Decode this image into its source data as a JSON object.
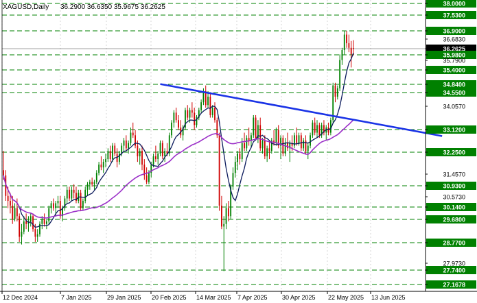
{
  "header": {
    "symbol": "XAGUSD,Daily",
    "ohlc": "36.2900 36.6350 35.9675 36.2625"
  },
  "colors": {
    "background": "#ffffff",
    "grid": "#b9b9b9",
    "level_line": "#008000",
    "level_label_bg": "#008000",
    "level_label_text": "#ffffff",
    "price_label_bg": "#000000",
    "price_label_text": "#ffffff",
    "bull_candle": "#008000",
    "bear_candle": "#d00000",
    "ma_fast": "#0b1a5c",
    "ma_slow": "#9b30c8",
    "trendline": "#1a33e6",
    "axis_text": "#000000"
  },
  "chart_data": {
    "type": "candlestick",
    "symbol": "XAGUSD",
    "timeframe": "Daily",
    "grid": true,
    "ylim": [
      27.0,
      38.1
    ],
    "x_tick_labels": [
      "12 Dec 2024",
      "7 Jan 2025",
      "29 Jan 2025",
      "20 Feb 2025",
      "14 Mar 2025",
      "7 Apr 2025",
      "30 Apr 2025",
      "22 May 2025",
      "13 Jun 2025"
    ],
    "y_axis_labels": [
      {
        "value": 38.0,
        "label": "38.0000",
        "style": "level"
      },
      {
        "value": 37.53,
        "label": "37.5300",
        "style": "level"
      },
      {
        "value": 36.9,
        "label": "36.9000",
        "style": "level"
      },
      {
        "value": 36.683,
        "label": "36.6830",
        "style": "plain"
      },
      {
        "value": 36.2625,
        "label": "36.2625",
        "style": "price"
      },
      {
        "value": 35.98,
        "label": "35.9800",
        "style": "level"
      },
      {
        "value": 35.79,
        "label": "35.7900",
        "style": "plain"
      },
      {
        "value": 35.4,
        "label": "35.4000",
        "style": "level"
      },
      {
        "value": 34.84,
        "label": "34.8400",
        "style": "level"
      },
      {
        "value": 34.55,
        "label": "34.5500",
        "style": "level"
      },
      {
        "value": 34.057,
        "label": "34.0570",
        "style": "plain"
      },
      {
        "value": 33.12,
        "label": "33.1200",
        "style": "level"
      },
      {
        "value": 32.25,
        "label": "32.2500",
        "style": "level"
      },
      {
        "value": 31.457,
        "label": "31.4570",
        "style": "plain"
      },
      {
        "value": 30.93,
        "label": "30.9300",
        "style": "level"
      },
      {
        "value": 30.573,
        "label": "30.5730",
        "style": "plain"
      },
      {
        "value": 30.14,
        "label": "30.1400",
        "style": "level"
      },
      {
        "value": 29.68,
        "label": "29.6800",
        "style": "level"
      },
      {
        "value": 28.77,
        "label": "28.7700",
        "style": "level"
      },
      {
        "value": 27.973,
        "label": "27.9730",
        "style": "plain"
      },
      {
        "value": 27.74,
        "label": "27.7400",
        "style": "level"
      },
      {
        "value": 27.1678,
        "label": "27.1678",
        "style": "level"
      }
    ],
    "horizontal_levels": [
      38.0,
      37.53,
      36.9,
      35.98,
      35.4,
      34.84,
      34.55,
      33.12,
      32.25,
      30.93,
      30.14,
      29.68,
      28.77,
      27.74,
      27.1678
    ],
    "current_price": 36.2625,
    "trendline": {
      "from": {
        "bar": 69,
        "value": 34.85
      },
      "to": {
        "bar": 193,
        "value": 32.87
      }
    },
    "candles": [
      {
        "o": 31.6,
        "h": 32.3,
        "l": 31.2,
        "c": 31.4
      },
      {
        "o": 31.4,
        "h": 31.6,
        "l": 30.4,
        "c": 30.6
      },
      {
        "o": 30.6,
        "h": 30.9,
        "l": 30.1,
        "c": 30.4
      },
      {
        "o": 30.4,
        "h": 30.7,
        "l": 29.9,
        "c": 30.2
      },
      {
        "o": 30.2,
        "h": 30.6,
        "l": 29.5,
        "c": 29.7
      },
      {
        "o": 29.7,
        "h": 30.3,
        "l": 29.6,
        "c": 30.1
      },
      {
        "o": 30.1,
        "h": 30.5,
        "l": 29.6,
        "c": 29.8
      },
      {
        "o": 29.8,
        "h": 29.9,
        "l": 28.8,
        "c": 29.0
      },
      {
        "o": 29.0,
        "h": 29.5,
        "l": 28.7,
        "c": 29.2
      },
      {
        "o": 29.2,
        "h": 29.8,
        "l": 29.1,
        "c": 29.6
      },
      {
        "o": 29.6,
        "h": 29.9,
        "l": 29.3,
        "c": 29.5
      },
      {
        "o": 29.5,
        "h": 29.8,
        "l": 29.2,
        "c": 29.6
      },
      {
        "o": 29.6,
        "h": 29.9,
        "l": 29.4,
        "c": 29.8
      },
      {
        "o": 29.8,
        "h": 29.9,
        "l": 29.2,
        "c": 29.3
      },
      {
        "o": 29.3,
        "h": 29.5,
        "l": 28.8,
        "c": 29.0
      },
      {
        "o": 29.0,
        "h": 29.3,
        "l": 28.8,
        "c": 29.1
      },
      {
        "o": 29.1,
        "h": 29.6,
        "l": 29.0,
        "c": 29.5
      },
      {
        "o": 29.5,
        "h": 29.8,
        "l": 29.3,
        "c": 29.7
      },
      {
        "o": 29.7,
        "h": 29.9,
        "l": 29.4,
        "c": 29.5
      },
      {
        "o": 29.5,
        "h": 29.7,
        "l": 29.3,
        "c": 29.6
      },
      {
        "o": 29.6,
        "h": 30.2,
        "l": 29.5,
        "c": 30.1
      },
      {
        "o": 30.1,
        "h": 30.4,
        "l": 29.9,
        "c": 30.3
      },
      {
        "o": 30.3,
        "h": 30.5,
        "l": 30.0,
        "c": 30.1
      },
      {
        "o": 30.1,
        "h": 30.4,
        "l": 29.8,
        "c": 30.3
      },
      {
        "o": 30.3,
        "h": 30.6,
        "l": 30.1,
        "c": 30.4
      },
      {
        "o": 30.4,
        "h": 30.6,
        "l": 29.7,
        "c": 29.8
      },
      {
        "o": 29.8,
        "h": 30.2,
        "l": 29.6,
        "c": 30.1
      },
      {
        "o": 30.1,
        "h": 30.6,
        "l": 30.0,
        "c": 30.5
      },
      {
        "o": 30.5,
        "h": 30.9,
        "l": 30.3,
        "c": 30.8
      },
      {
        "o": 30.8,
        "h": 30.9,
        "l": 30.4,
        "c": 30.5
      },
      {
        "o": 30.5,
        "h": 30.9,
        "l": 30.4,
        "c": 30.8
      },
      {
        "o": 30.8,
        "h": 31.0,
        "l": 30.5,
        "c": 30.7
      },
      {
        "o": 30.7,
        "h": 30.9,
        "l": 30.3,
        "c": 30.4
      },
      {
        "o": 30.4,
        "h": 30.8,
        "l": 30.3,
        "c": 30.7
      },
      {
        "o": 30.7,
        "h": 30.8,
        "l": 30.0,
        "c": 30.1
      },
      {
        "o": 30.1,
        "h": 30.5,
        "l": 30.0,
        "c": 30.4
      },
      {
        "o": 30.4,
        "h": 30.9,
        "l": 30.3,
        "c": 30.8
      },
      {
        "o": 30.8,
        "h": 31.1,
        "l": 30.6,
        "c": 31.0
      },
      {
        "o": 31.0,
        "h": 31.2,
        "l": 30.8,
        "c": 31.1
      },
      {
        "o": 31.1,
        "h": 31.3,
        "l": 30.9,
        "c": 31.0
      },
      {
        "o": 31.0,
        "h": 31.2,
        "l": 30.8,
        "c": 31.1
      },
      {
        "o": 31.1,
        "h": 31.6,
        "l": 31.0,
        "c": 31.5
      },
      {
        "o": 31.5,
        "h": 31.9,
        "l": 31.4,
        "c": 31.8
      },
      {
        "o": 31.8,
        "h": 32.1,
        "l": 31.6,
        "c": 31.7
      },
      {
        "o": 31.7,
        "h": 32.0,
        "l": 31.5,
        "c": 31.9
      },
      {
        "o": 31.9,
        "h": 32.2,
        "l": 31.7,
        "c": 32.0
      },
      {
        "o": 32.0,
        "h": 32.4,
        "l": 31.9,
        "c": 32.3
      },
      {
        "o": 32.3,
        "h": 32.5,
        "l": 31.9,
        "c": 32.0
      },
      {
        "o": 32.0,
        "h": 32.6,
        "l": 31.9,
        "c": 32.5
      },
      {
        "o": 32.5,
        "h": 32.6,
        "l": 32.1,
        "c": 32.2
      },
      {
        "o": 32.2,
        "h": 32.4,
        "l": 31.7,
        "c": 31.9
      },
      {
        "o": 31.9,
        "h": 32.3,
        "l": 31.8,
        "c": 32.2
      },
      {
        "o": 32.2,
        "h": 32.6,
        "l": 32.1,
        "c": 32.5
      },
      {
        "o": 32.5,
        "h": 32.8,
        "l": 32.3,
        "c": 32.7
      },
      {
        "o": 32.7,
        "h": 32.9,
        "l": 32.3,
        "c": 32.4
      },
      {
        "o": 32.4,
        "h": 32.7,
        "l": 32.2,
        "c": 32.6
      },
      {
        "o": 32.6,
        "h": 33.2,
        "l": 32.5,
        "c": 33.0
      },
      {
        "o": 33.0,
        "h": 33.4,
        "l": 32.8,
        "c": 32.9
      },
      {
        "o": 32.9,
        "h": 33.1,
        "l": 32.4,
        "c": 32.5
      },
      {
        "o": 32.5,
        "h": 32.7,
        "l": 31.9,
        "c": 32.1
      },
      {
        "o": 32.1,
        "h": 32.4,
        "l": 31.8,
        "c": 32.3
      },
      {
        "o": 32.3,
        "h": 32.5,
        "l": 31.6,
        "c": 31.8
      },
      {
        "o": 31.8,
        "h": 32.0,
        "l": 31.2,
        "c": 31.4
      },
      {
        "o": 31.4,
        "h": 31.7,
        "l": 31.0,
        "c": 31.1
      },
      {
        "o": 31.1,
        "h": 31.6,
        "l": 31.0,
        "c": 31.5
      },
      {
        "o": 31.5,
        "h": 31.9,
        "l": 31.3,
        "c": 31.8
      },
      {
        "o": 31.8,
        "h": 32.2,
        "l": 31.7,
        "c": 32.1
      },
      {
        "o": 32.1,
        "h": 32.5,
        "l": 31.9,
        "c": 32.0
      },
      {
        "o": 32.0,
        "h": 32.3,
        "l": 31.8,
        "c": 32.2
      },
      {
        "o": 32.2,
        "h": 32.7,
        "l": 32.1,
        "c": 32.6
      },
      {
        "o": 32.6,
        "h": 32.7,
        "l": 32.0,
        "c": 32.1
      },
      {
        "o": 32.1,
        "h": 32.4,
        "l": 31.9,
        "c": 32.3
      },
      {
        "o": 32.3,
        "h": 32.6,
        "l": 32.1,
        "c": 32.2
      },
      {
        "o": 32.2,
        "h": 33.0,
        "l": 32.1,
        "c": 32.9
      },
      {
        "o": 32.9,
        "h": 33.5,
        "l": 32.8,
        "c": 33.4
      },
      {
        "o": 33.4,
        "h": 33.9,
        "l": 33.2,
        "c": 33.8
      },
      {
        "o": 33.8,
        "h": 34.0,
        "l": 33.4,
        "c": 33.5
      },
      {
        "o": 33.5,
        "h": 33.7,
        "l": 33.1,
        "c": 33.2
      },
      {
        "o": 33.2,
        "h": 33.5,
        "l": 32.8,
        "c": 32.9
      },
      {
        "o": 32.9,
        "h": 33.3,
        "l": 32.7,
        "c": 33.2
      },
      {
        "o": 33.2,
        "h": 34.0,
        "l": 33.1,
        "c": 33.9
      },
      {
        "o": 33.9,
        "h": 34.1,
        "l": 33.5,
        "c": 33.6
      },
      {
        "o": 33.6,
        "h": 34.0,
        "l": 33.4,
        "c": 33.9
      },
      {
        "o": 33.9,
        "h": 34.2,
        "l": 33.6,
        "c": 33.8
      },
      {
        "o": 33.8,
        "h": 34.0,
        "l": 33.1,
        "c": 33.3
      },
      {
        "o": 33.3,
        "h": 33.7,
        "l": 33.2,
        "c": 33.6
      },
      {
        "o": 33.6,
        "h": 34.0,
        "l": 33.5,
        "c": 33.9
      },
      {
        "o": 33.9,
        "h": 34.3,
        "l": 33.8,
        "c": 34.2
      },
      {
        "o": 34.2,
        "h": 34.7,
        "l": 34.1,
        "c": 34.6
      },
      {
        "o": 34.6,
        "h": 34.8,
        "l": 34.0,
        "c": 34.1
      },
      {
        "o": 34.1,
        "h": 34.6,
        "l": 34.0,
        "c": 34.4
      },
      {
        "o": 34.4,
        "h": 34.5,
        "l": 33.6,
        "c": 33.7
      },
      {
        "o": 33.7,
        "h": 34.1,
        "l": 33.6,
        "c": 34.0
      },
      {
        "o": 34.0,
        "h": 34.2,
        "l": 33.4,
        "c": 33.5
      },
      {
        "o": 33.5,
        "h": 33.6,
        "l": 32.8,
        "c": 32.9
      },
      {
        "o": 32.9,
        "h": 33.0,
        "l": 30.0,
        "c": 30.2
      },
      {
        "o": 30.2,
        "h": 30.6,
        "l": 29.3,
        "c": 29.4
      },
      {
        "o": 29.4,
        "h": 29.8,
        "l": 27.7,
        "c": 29.5
      },
      {
        "o": 29.5,
        "h": 30.3,
        "l": 29.3,
        "c": 30.1
      },
      {
        "o": 30.1,
        "h": 30.4,
        "l": 29.6,
        "c": 29.8
      },
      {
        "o": 29.8,
        "h": 31.0,
        "l": 29.7,
        "c": 30.9
      },
      {
        "o": 30.9,
        "h": 31.7,
        "l": 30.8,
        "c": 31.5
      },
      {
        "o": 31.5,
        "h": 32.1,
        "l": 31.3,
        "c": 31.9
      },
      {
        "o": 31.9,
        "h": 32.3,
        "l": 31.6,
        "c": 32.2
      },
      {
        "o": 32.2,
        "h": 32.4,
        "l": 31.8,
        "c": 32.0
      },
      {
        "o": 32.0,
        "h": 32.8,
        "l": 31.9,
        "c": 32.6
      },
      {
        "o": 32.6,
        "h": 33.0,
        "l": 32.3,
        "c": 32.4
      },
      {
        "o": 32.4,
        "h": 32.9,
        "l": 32.3,
        "c": 32.8
      },
      {
        "o": 32.8,
        "h": 33.2,
        "l": 32.5,
        "c": 32.7
      },
      {
        "o": 32.7,
        "h": 33.0,
        "l": 32.4,
        "c": 32.9
      },
      {
        "o": 32.9,
        "h": 33.7,
        "l": 32.8,
        "c": 33.6
      },
      {
        "o": 33.6,
        "h": 33.7,
        "l": 32.7,
        "c": 32.8
      },
      {
        "o": 32.8,
        "h": 33.5,
        "l": 32.6,
        "c": 33.3
      },
      {
        "o": 33.3,
        "h": 33.6,
        "l": 32.3,
        "c": 32.4
      },
      {
        "o": 32.4,
        "h": 32.8,
        "l": 32.2,
        "c": 32.7
      },
      {
        "o": 32.7,
        "h": 32.9,
        "l": 32.0,
        "c": 32.1
      },
      {
        "o": 32.1,
        "h": 32.5,
        "l": 31.9,
        "c": 32.4
      },
      {
        "o": 32.4,
        "h": 32.7,
        "l": 32.0,
        "c": 32.3
      },
      {
        "o": 32.3,
        "h": 32.8,
        "l": 32.2,
        "c": 32.7
      },
      {
        "o": 32.7,
        "h": 33.1,
        "l": 32.5,
        "c": 32.6
      },
      {
        "o": 32.6,
        "h": 33.2,
        "l": 32.5,
        "c": 33.1
      },
      {
        "o": 33.1,
        "h": 33.3,
        "l": 32.4,
        "c": 32.5
      },
      {
        "o": 32.5,
        "h": 32.9,
        "l": 32.0,
        "c": 32.8
      },
      {
        "o": 32.8,
        "h": 32.9,
        "l": 32.1,
        "c": 32.2
      },
      {
        "o": 32.2,
        "h": 32.8,
        "l": 32.1,
        "c": 32.6
      },
      {
        "o": 32.6,
        "h": 33.0,
        "l": 32.3,
        "c": 32.4
      },
      {
        "o": 32.4,
        "h": 32.7,
        "l": 31.9,
        "c": 32.6
      },
      {
        "o": 32.6,
        "h": 32.9,
        "l": 32.3,
        "c": 32.5
      },
      {
        "o": 32.5,
        "h": 33.0,
        "l": 32.4,
        "c": 32.9
      },
      {
        "o": 32.9,
        "h": 33.2,
        "l": 32.5,
        "c": 32.6
      },
      {
        "o": 32.6,
        "h": 33.0,
        "l": 32.5,
        "c": 32.9
      },
      {
        "o": 32.9,
        "h": 33.0,
        "l": 32.3,
        "c": 32.4
      },
      {
        "o": 32.4,
        "h": 32.8,
        "l": 32.3,
        "c": 32.7
      },
      {
        "o": 32.7,
        "h": 32.9,
        "l": 32.2,
        "c": 32.3
      },
      {
        "o": 32.3,
        "h": 32.6,
        "l": 32.0,
        "c": 32.5
      },
      {
        "o": 32.5,
        "h": 33.0,
        "l": 32.4,
        "c": 32.9
      },
      {
        "o": 32.9,
        "h": 33.5,
        "l": 32.8,
        "c": 33.4
      },
      {
        "o": 33.4,
        "h": 33.6,
        "l": 32.9,
        "c": 33.0
      },
      {
        "o": 33.0,
        "h": 33.5,
        "l": 32.8,
        "c": 33.3
      },
      {
        "o": 33.3,
        "h": 33.4,
        "l": 32.8,
        "c": 32.9
      },
      {
        "o": 32.9,
        "h": 33.4,
        "l": 32.8,
        "c": 33.3
      },
      {
        "o": 33.3,
        "h": 33.5,
        "l": 32.9,
        "c": 33.0
      },
      {
        "o": 33.0,
        "h": 33.3,
        "l": 32.7,
        "c": 33.2
      },
      {
        "o": 33.2,
        "h": 33.4,
        "l": 32.9,
        "c": 33.0
      },
      {
        "o": 33.0,
        "h": 33.6,
        "l": 32.9,
        "c": 33.5
      },
      {
        "o": 33.5,
        "h": 34.9,
        "l": 33.4,
        "c": 34.8
      },
      {
        "o": 34.8,
        "h": 34.9,
        "l": 34.2,
        "c": 34.4
      },
      {
        "o": 34.4,
        "h": 34.8,
        "l": 34.3,
        "c": 34.7
      },
      {
        "o": 34.7,
        "h": 36.0,
        "l": 34.6,
        "c": 35.8
      },
      {
        "o": 35.8,
        "h": 36.3,
        "l": 35.6,
        "c": 36.2
      },
      {
        "o": 36.2,
        "h": 36.9,
        "l": 36.0,
        "c": 36.8
      },
      {
        "o": 36.8,
        "h": 36.9,
        "l": 36.3,
        "c": 36.5
      },
      {
        "o": 36.5,
        "h": 36.8,
        "l": 36.1,
        "c": 36.3
      },
      {
        "o": 36.3,
        "h": 36.6,
        "l": 35.5,
        "c": 36.0
      },
      {
        "o": 36.29,
        "h": 36.635,
        "l": 35.9675,
        "c": 36.2625
      }
    ]
  }
}
